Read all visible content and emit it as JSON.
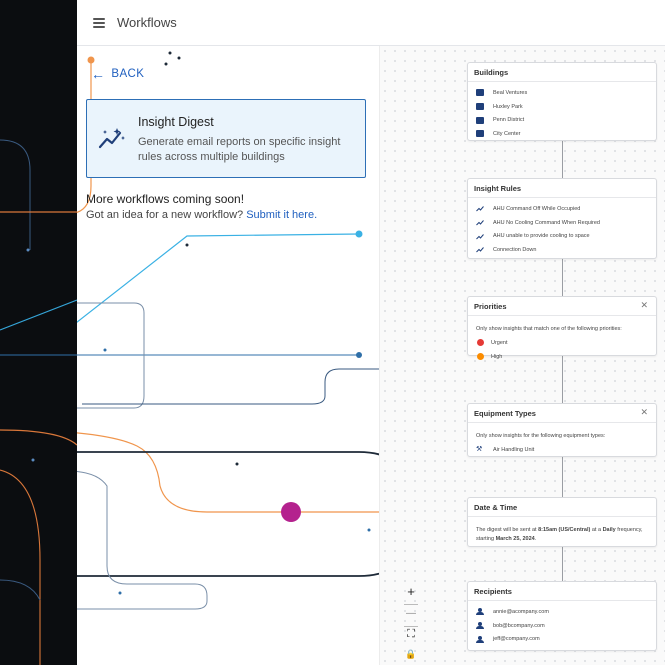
{
  "header": {
    "title": "Workflows",
    "menu_icon": "menu-icon"
  },
  "left": {
    "back_label": "BACK",
    "card": {
      "title": "Insight Digest",
      "description": "Generate email reports on specific insight rules across multiple buildings",
      "icon": "sparkle-chart-icon"
    },
    "more_title": "More workflows coming soon!",
    "more_prefix": "Got an idea for a new workflow? ",
    "more_link": "Submit it here."
  },
  "flow": {
    "buildings": {
      "title": "Buildings",
      "items": [
        "Beal Ventures",
        "Huxley Park",
        "Penn District",
        "City Center"
      ]
    },
    "insight_rules": {
      "title": "Insight Rules",
      "items": [
        "AHU Command Off While Occupied",
        "AHU No Cooling Command When Required",
        "AHU unable to provide cooling to space",
        "Connection Down"
      ]
    },
    "priorities": {
      "title": "Priorities",
      "close": "✕",
      "note": "Only show insights that match one of the following priorities:",
      "items": [
        {
          "label": "Urgent",
          "color": "#e53935"
        },
        {
          "label": "High",
          "color": "#fb8c00"
        }
      ]
    },
    "equipment": {
      "title": "Equipment Types",
      "close": "✕",
      "note": "Only show insights for the following equipment types:",
      "items": [
        "Air Handling Unit"
      ]
    },
    "datetime": {
      "title": "Date & Time",
      "p1": "The digest will be sent at ",
      "time": "8:15am (US/Central)",
      "p2": " at a ",
      "freq": "Daily",
      "p3": " frequency, starting ",
      "date": "March 25, 2024",
      "p4": "."
    },
    "recipients": {
      "title": "Recipients",
      "items": [
        "annie@acompany.com",
        "bob@bcompany.com",
        "jeff@company.com"
      ]
    }
  },
  "controls": {
    "zoom_in": "+",
    "zoom_out": "—",
    "fit": "⛶",
    "lock": "🔒"
  }
}
